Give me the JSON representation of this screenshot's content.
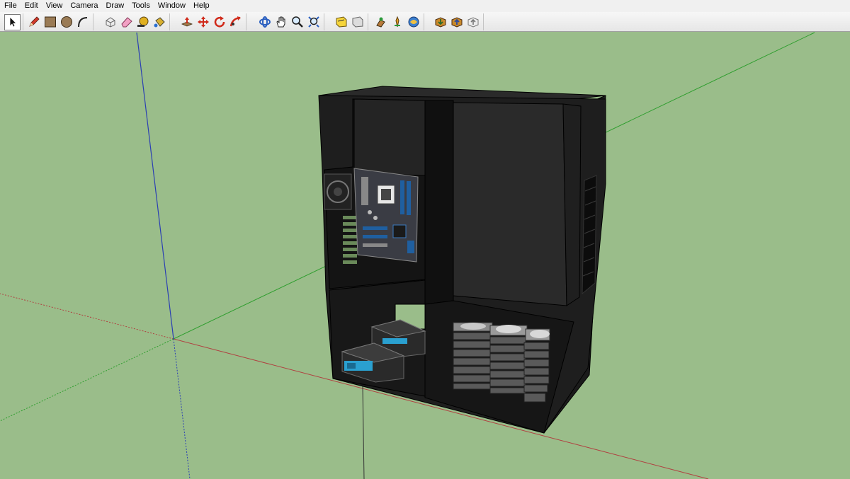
{
  "menu": {
    "file": "File",
    "edit": "Edit",
    "view": "View",
    "camera": "Camera",
    "draw": "Draw",
    "tools": "Tools",
    "window": "Window",
    "help": "Help"
  },
  "toolbar": {
    "groups": [
      {
        "tools": [
          "select-icon"
        ]
      },
      {
        "tools": [
          "pencil-icon",
          "rectangle-icon",
          "circle-icon",
          "arc-icon"
        ]
      },
      {
        "tools": [
          "make-component-icon",
          "eraser-icon",
          "tape-measure-icon",
          "paint-bucket-icon"
        ]
      },
      {
        "tools": [
          "push-pull-icon",
          "move-icon",
          "rotate-icon",
          "follow-me-icon"
        ]
      },
      {
        "tools": [
          "orbit-icon",
          "pan-icon",
          "zoom-icon",
          "zoom-extents-icon"
        ]
      },
      {
        "tools": [
          "section-plane-icon",
          "display-section-icon"
        ]
      },
      {
        "tools": [
          "walk-icon",
          "position-camera-icon",
          "look-around-icon"
        ]
      },
      {
        "tools": [
          "get-models-icon",
          "share-model-icon",
          "share-component-icon"
        ]
      }
    ]
  },
  "viewport": {
    "background_color": "#9abd8a",
    "axis_colors": {
      "red": "#b04040",
      "green": "#2e9e2e",
      "blue": "#2b3fb3"
    },
    "model": "computer-case-3d-model"
  }
}
